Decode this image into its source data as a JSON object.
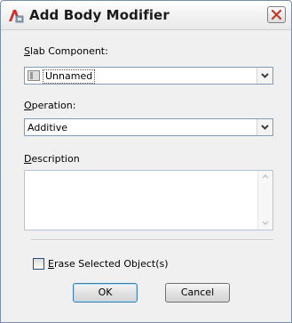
{
  "window": {
    "title": "Add Body Modifier",
    "app_icon": "autocad-architecture-icon",
    "close_icon": "close-icon"
  },
  "slab_component": {
    "label_mnemonic": "S",
    "label_rest": "lab Component:",
    "value": "Unnamed",
    "icon": "slab-component-icon"
  },
  "operation": {
    "label_mnemonic": "O",
    "label_rest": "peration:",
    "value": "Additive"
  },
  "description": {
    "label_mnemonic": "D",
    "label_rest": "escription",
    "value": ""
  },
  "erase_checkbox": {
    "label_mnemonic": "E",
    "label_rest": "rase Selected Object(s)",
    "checked": false
  },
  "buttons": {
    "ok": "OK",
    "cancel": "Cancel"
  },
  "colors": {
    "close_x": "#c0392b",
    "window_border": "#7a8ea6",
    "input_border": "#7f9db9"
  }
}
